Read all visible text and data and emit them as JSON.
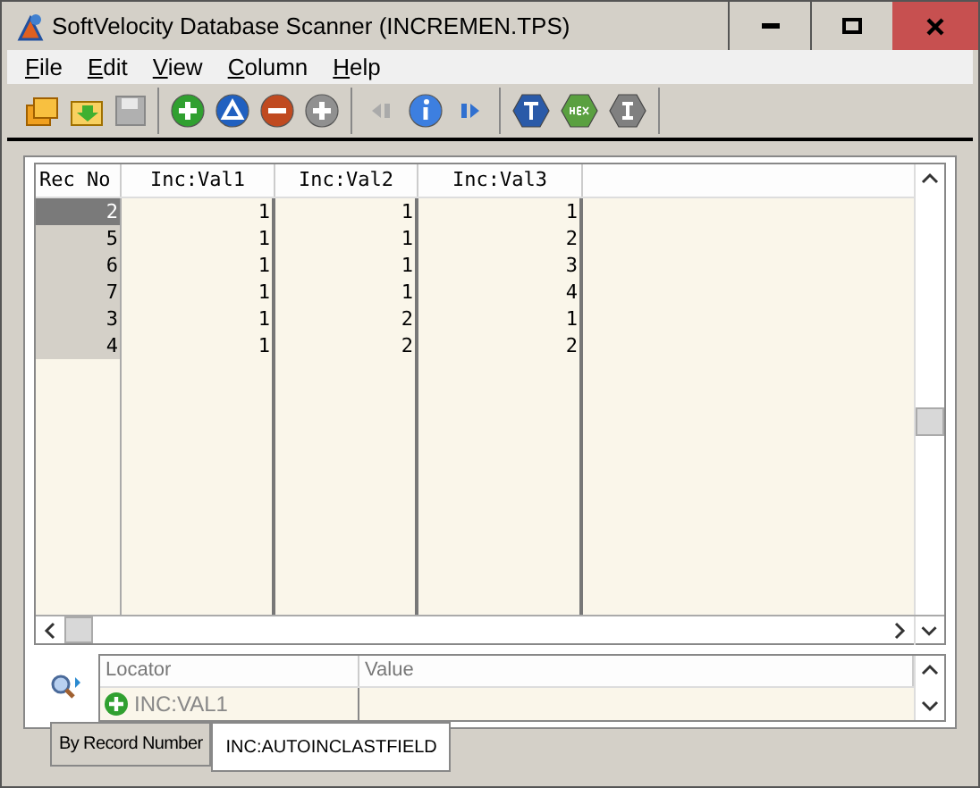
{
  "window": {
    "title": "SoftVelocity Database Scanner (INCREMEN.TPS)"
  },
  "menu": [
    "File",
    "Edit",
    "View",
    "Column",
    "Help"
  ],
  "table": {
    "columns": [
      "Rec No",
      "Inc:Val1",
      "Inc:Val2",
      "Inc:Val3"
    ],
    "rows": [
      {
        "cells": [
          "2",
          "1",
          "1",
          "1"
        ],
        "selected": true
      },
      {
        "cells": [
          "5",
          "1",
          "1",
          "2"
        ],
        "selected": false
      },
      {
        "cells": [
          "6",
          "1",
          "1",
          "3"
        ],
        "selected": false
      },
      {
        "cells": [
          "7",
          "1",
          "1",
          "4"
        ],
        "selected": false
      },
      {
        "cells": [
          "3",
          "1",
          "2",
          "1"
        ],
        "selected": false
      },
      {
        "cells": [
          "4",
          "1",
          "2",
          "2"
        ],
        "selected": false
      }
    ]
  },
  "locator": {
    "columns": [
      "Locator",
      "Value"
    ],
    "rows": [
      {
        "locator": "INC:VAL1"
      }
    ]
  },
  "tabs": [
    {
      "label": "By Record Number",
      "selected": false
    },
    {
      "label": "INC:AUTOINCLASTFIELD",
      "selected": true
    }
  ]
}
